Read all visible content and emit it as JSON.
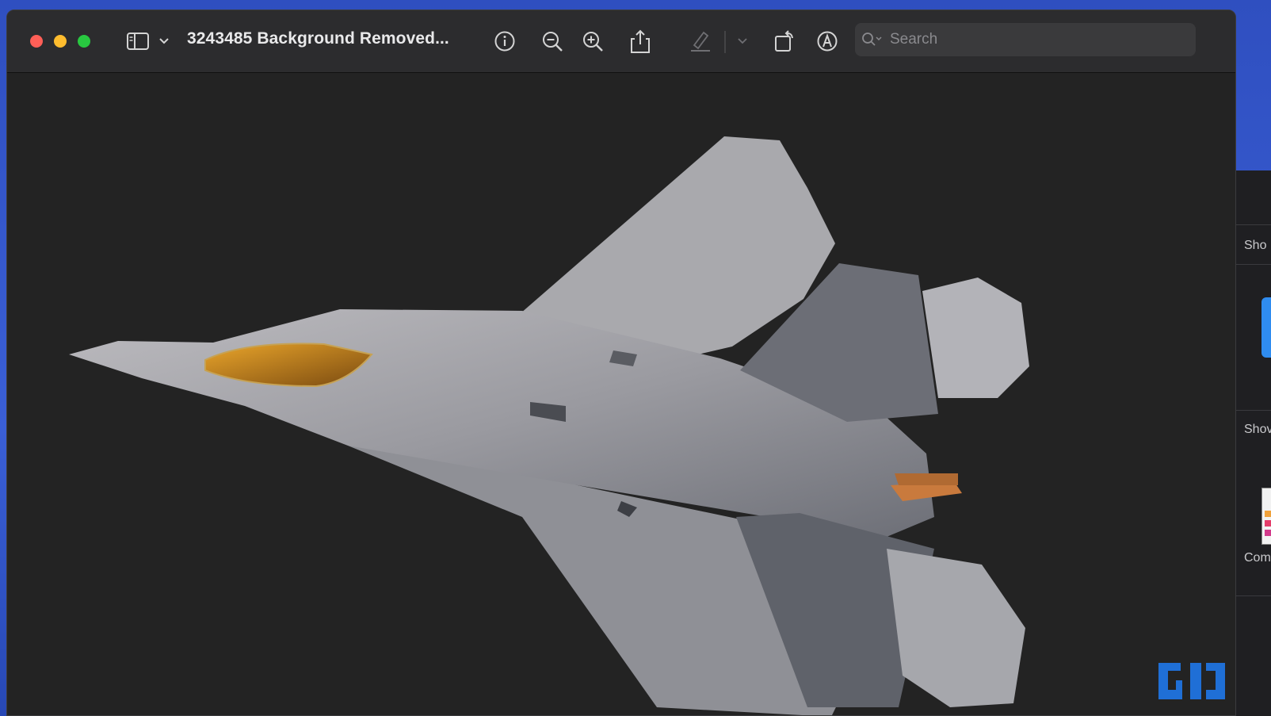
{
  "window": {
    "title": "3243485 Background Removed...",
    "traffic_lights": {
      "close": "#ff5f57",
      "minimize": "#febc2e",
      "zoom": "#28c840"
    }
  },
  "toolbar": {
    "sidebar_toggle_icon": "sidebar-icon",
    "info_icon": "info-icon",
    "zoom_out_icon": "zoom-out-icon",
    "zoom_in_icon": "zoom-in-icon",
    "share_icon": "share-icon",
    "highlight_icon": "highlighter-icon",
    "rotate_icon": "rotate-icon",
    "markup_icon": "markup-icon"
  },
  "search": {
    "placeholder": "Search"
  },
  "document": {
    "image_subject": "fighter jet",
    "background": "#232323"
  },
  "background_window": {
    "labels": [
      "Sho",
      "Shov",
      "Com"
    ]
  }
}
